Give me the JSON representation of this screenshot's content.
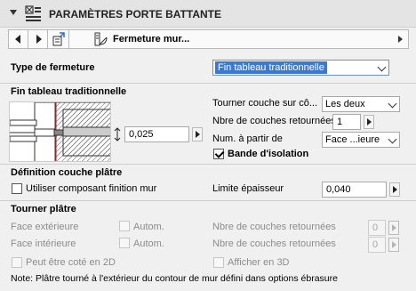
{
  "header": {
    "title": "PARAMÈTRES PORTE BATTANTE"
  },
  "navbar": {
    "label": "Fermeture mur..."
  },
  "closure_type": {
    "label": "Type de fermeture",
    "value": "Fin tableau traditionnelle"
  },
  "section_fin": {
    "title": "Fin tableau traditionnelle",
    "dimension_value": "0,025",
    "turn_layer_label": "Tourner couche sur cô...",
    "turn_layer_value": "Les deux",
    "layers_returned_label": "Nbre de couches retournées",
    "layers_returned_value": "1",
    "num_from_label": "Num. à partir de",
    "num_from_value": "Face ...ieure",
    "insulation_label": "Bande d'isolation"
  },
  "plaster_def": {
    "title": "Définition couche plâtre",
    "use_finish_label": "Utiliser composant finition mur",
    "thickness_limit_label": "Limite épaisseur",
    "thickness_limit_value": "0,040"
  },
  "turn_plaster": {
    "title": "Tourner plâtre",
    "outer_face_label": "Face extérieure",
    "inner_face_label": "Face intérieure",
    "auto_label": "Autom.",
    "layers_label": "Nbre de couches retournées",
    "layers_value": "0"
  },
  "options": {
    "dimensionable_2d": "Peut être coté en 2D",
    "show_3d": "Afficher en 3D"
  },
  "note": "Note: Plâtre tourné à l'extérieur du contour de mur défini dans options ébrasure",
  "colors": {
    "accent": "#3a79d6",
    "reveal_red": "#e02020"
  }
}
